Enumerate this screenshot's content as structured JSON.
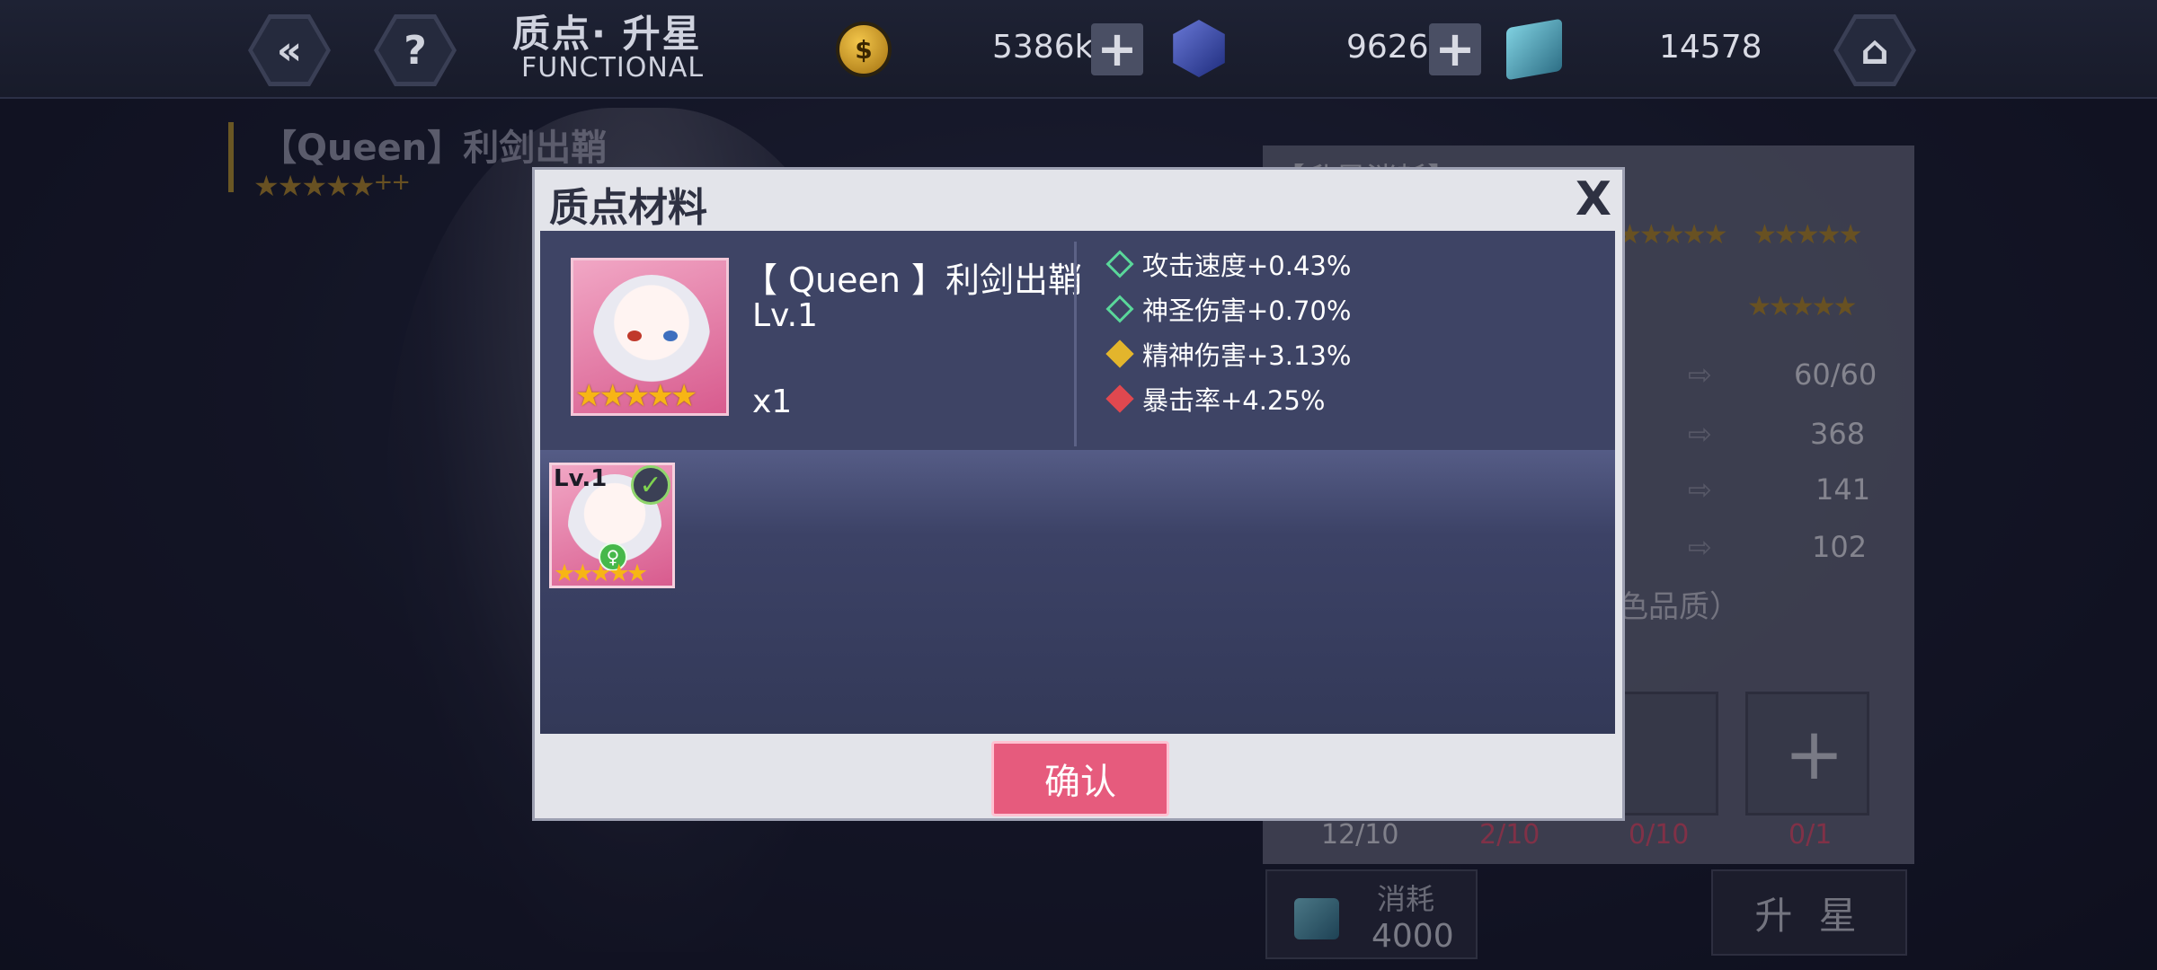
{
  "header": {
    "title_cn": "质点· 升星",
    "title_en": "FUNCTIONAL",
    "back_icon": "back-arrow-icon",
    "help_icon": "question-icon",
    "home_icon": "home-icon",
    "coin_glyph": "$",
    "gold_value": "5386k",
    "crystal_value": "9626",
    "cube_value": "14578",
    "plus": "+"
  },
  "background": {
    "character_name": "【Queen】利剑出鞘",
    "stars": "★★★★★",
    "plus_marks": "++",
    "panel_title": "【升星消耗】",
    "stats": [
      {
        "value": "60/60"
      },
      {
        "value": "368"
      },
      {
        "value": "141"
      },
      {
        "value": "102"
      }
    ],
    "quality_note": "色品质）",
    "slot_counts": [
      {
        "value": "12/10",
        "color": "#e0e1e8"
      },
      {
        "value": "2/10",
        "color": "#e0506e"
      },
      {
        "value": "0/10",
        "color": "#e0506e"
      },
      {
        "value": "0/1",
        "color": "#e0506e"
      }
    ],
    "consume_label": "消耗",
    "consume_value": "4000",
    "starup_label": "升 星"
  },
  "modal": {
    "title": "质点材料",
    "close": "X",
    "item": {
      "name": "【 Queen 】利剑出鞘",
      "level": "Lv.1",
      "quantity": "x1",
      "stars": "★★★★★"
    },
    "attributes": [
      {
        "label": "攻击速度+0.43%",
        "color": "#5ad79a"
      },
      {
        "label": "神圣伤害+0.70%",
        "color": "#5ad79a"
      },
      {
        "label": "精神伤害+3.13%",
        "color": "#e3b52c"
      },
      {
        "label": "暴击率+4.25%",
        "color": "#e0484f"
      }
    ],
    "materials": [
      {
        "level": "Lv.1",
        "stars": "★★★★★",
        "checked": true,
        "badge": "♀"
      }
    ],
    "confirm_label": "确认"
  }
}
